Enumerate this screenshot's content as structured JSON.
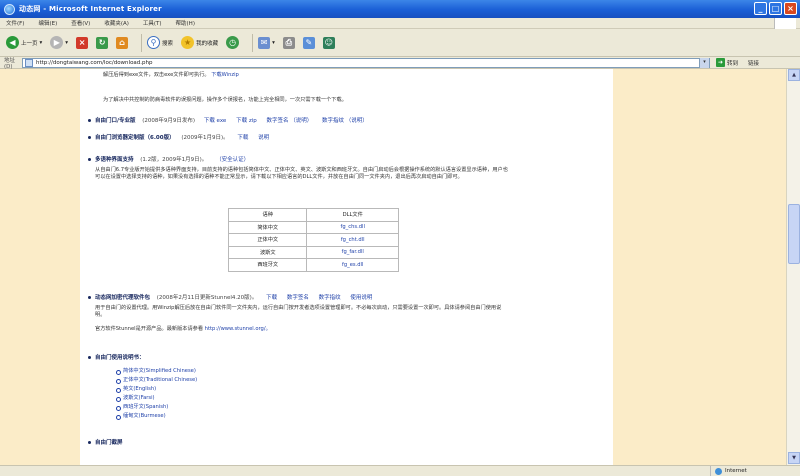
{
  "window": {
    "title": "动态网 - Microsoft Internet Explorer",
    "controls": [
      "_",
      "□",
      "×"
    ]
  },
  "menu": [
    "文件(F)",
    "编辑(E)",
    "查看(V)",
    "收藏夹(A)",
    "工具(T)",
    "帮助(H)"
  ],
  "toolbar": {
    "back": "上一页",
    "search": "搜索",
    "favorites": "我的收藏"
  },
  "address": {
    "label": "地址(D)",
    "url": "http://dongtaiwang.com/loc/download.php",
    "go": "转到",
    "links": "链接"
  },
  "content": {
    "top_line": "解压后得到exe文件，双击exe文件即可执行。",
    "top_link": "下载Winzip",
    "intro": "为了解决中共控制的防病毒软件的误报问题，操作多个误报名，功能上完全相同，一次只需下载一个下载。",
    "sections": [
      {
        "title": "自由门口/专业版",
        "note": "(2008年9月9日发布)",
        "links": [
          "下载  exe",
          "下载  zip",
          "数字签名 （说明）",
          "数字指纹 （说明）"
        ]
      },
      {
        "title": "自由门浏览器定制版（6.00版）",
        "note": "(2009年1月9日)。",
        "links": [
          "下载",
          "说明"
        ]
      },
      {
        "title": "多语种界面支持",
        "note": "(1.2版，2009年1月9日)。",
        "links": [
          "（安全认证）"
        ],
        "body": "从自由门6.7专业版开始提供多语种界面支持，目前支持的语种包括简体中文、正体中文、英文、波斯文和西班牙文。自由门启动后会根据操作系统的默认语言设置显示语种，用户也可以在设置中选择支持的语种，如果没有选择的语种不能正常显示，请下载以下相应语言的DLL文件，并放在自由门同一文件夹内，退出后再次启动自由门即可。"
      },
      {
        "title": "动态网加密代理软件包",
        "note": "(2008年2月11日更新Stunnel4.20版)。",
        "links": [
          "下载",
          "数字签名",
          "数字指纹",
          "使用说明"
        ],
        "body": "用于自由门的设置代理。用Winzip解压后放在自由门软件同一文件夹内，运行自由门按开发者选项设置管理即可。不必每次启动，只需要设置一次即可。具体请参阅自由门使用说明。",
        "body2": "官方软件Stunnel是开源产品。最新版本请参看",
        "body2_link": "http://www.stunnel.org/。"
      },
      {
        "title": "自由门使用说明书："
      },
      {
        "title": "自由门截屏"
      }
    ],
    "dll_table": {
      "headers": [
        "语种",
        "DLL文件"
      ],
      "rows": [
        [
          "简体中文",
          "fg_chs.dll"
        ],
        [
          "正体中文",
          "fg_cht.dll"
        ],
        [
          "波斯文",
          "fg_far.dll"
        ],
        [
          "西班牙文",
          "fg_es.dll"
        ]
      ]
    },
    "languages": [
      "简体中文(Simplified Chinese)",
      "正体中文(Traditional Chinese)",
      "英文(English)",
      "波斯文(Farsi)",
      "西班牙文(Spanish)",
      "缅甸文(Burmese)"
    ]
  },
  "status": {
    "text": "",
    "zone": "Internet"
  }
}
